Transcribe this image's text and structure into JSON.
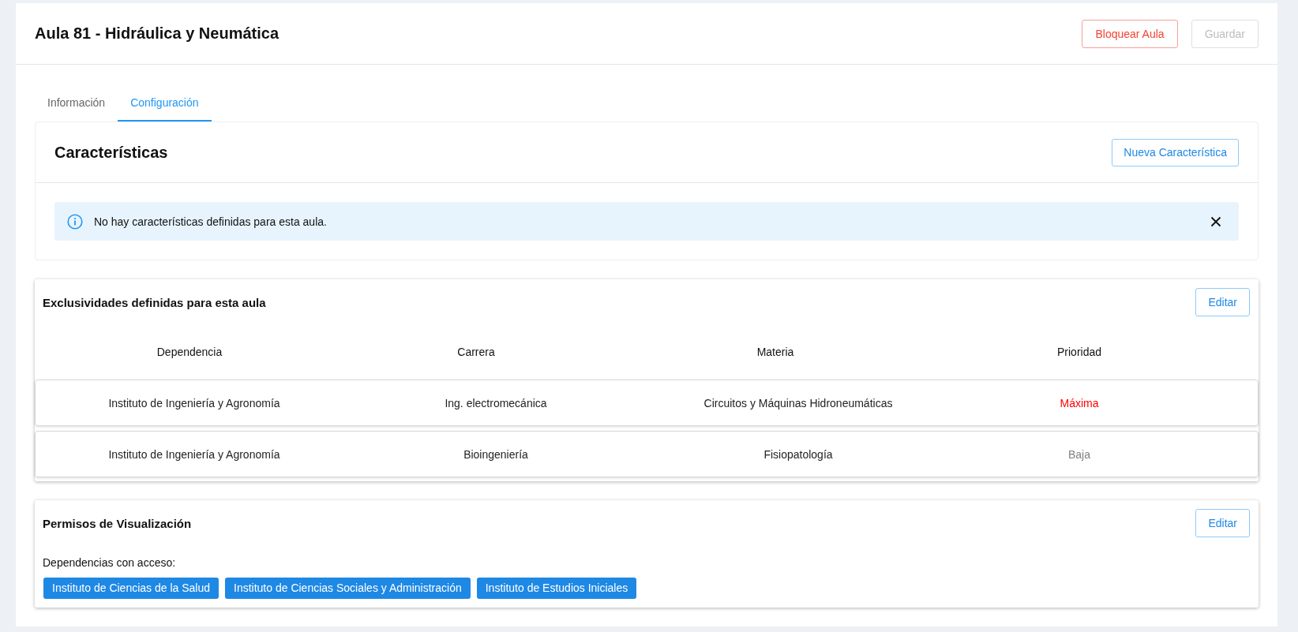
{
  "page": {
    "title": "Aula 81 - Hidráulica y Neumática",
    "actions": [
      {
        "label": "Bloquear Aula",
        "kind": "danger",
        "disabled": false
      },
      {
        "label": "Guardar",
        "kind": "primary",
        "disabled": true
      }
    ]
  },
  "tabs": [
    {
      "label": "Información",
      "selected": false
    },
    {
      "label": "Configuración",
      "selected": true
    }
  ],
  "caracteristicas": {
    "title": "Características",
    "button": "Nueva Característica",
    "alert": {
      "text": "No hay características definidas para esta aula."
    }
  },
  "exclusividades": {
    "title": "Exclusividades definidas para esta aula",
    "button": "Editar",
    "columns": [
      "Dependencia",
      "Carrera",
      "Materia",
      "Prioridad"
    ],
    "rows": [
      {
        "cells": [
          "Instituto de Ingeniería y Agronomía",
          "Ing. electromecánica",
          "Circuitos y Máquinas Hidroneumáticas"
        ],
        "priority": {
          "label": "Máxima",
          "color": "#ff0000"
        }
      },
      {
        "cells": [
          "Instituto de Ingeniería y Agronomía",
          "Bioingeniería",
          "Fisiopatología"
        ],
        "priority": {
          "label": "Baja",
          "color": "#808080"
        }
      }
    ]
  },
  "permisos": {
    "title": "Permisos de Visualización",
    "button": "Editar",
    "label": "Dependencias con acceso:",
    "chips": [
      "Instituto de Ciencias de la Salud",
      "Instituto de Ciencias Sociales y Administración",
      "Instituto de Estudios Iniciales"
    ]
  }
}
